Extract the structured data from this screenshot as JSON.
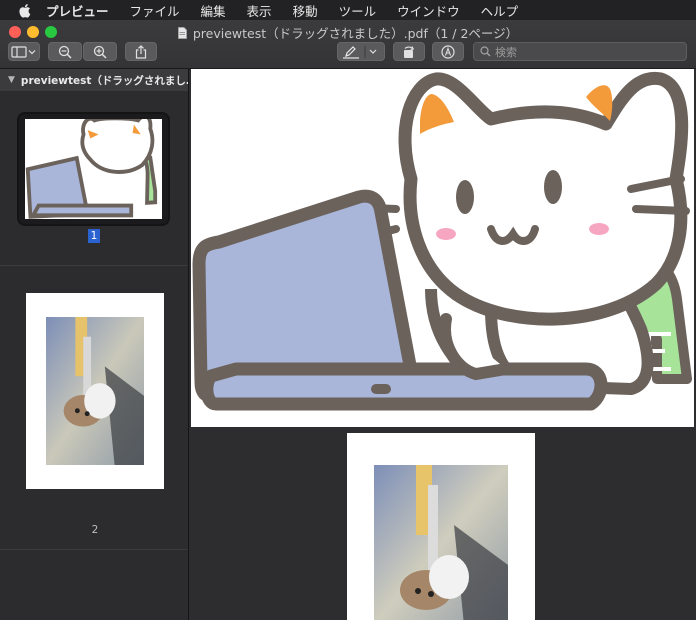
{
  "menubar": {
    "app_name": "プレビュー",
    "items": [
      "ファイル",
      "編集",
      "表示",
      "移動",
      "ツール",
      "ウインドウ",
      "ヘルプ"
    ]
  },
  "window": {
    "title": "previewtest（ドラッグされました）.pdf（1 / 2ページ）"
  },
  "toolbar": {
    "sidebar_button_icon": "sidebar-icon",
    "zoom_out_icon": "zoom-out-icon",
    "zoom_in_icon": "zoom-in-icon",
    "share_icon": "share-icon",
    "markup_icon": "pen-icon",
    "rotate_icon": "rotate-icon",
    "annotate_icon": "markup-circle-icon",
    "search_placeholder": "検索"
  },
  "sidebar": {
    "header": "previewtest（ドラッグされまし…",
    "pages": [
      {
        "number": "1",
        "selected": true
      },
      {
        "number": "2",
        "selected": false
      }
    ]
  },
  "colors": {
    "selection": "#2a62cf",
    "laptop": "#a9b6d9",
    "outline": "#6b625c",
    "ear": "#f39a3b",
    "cheek": "#f7a6c2",
    "chair": "#a8e39a"
  }
}
